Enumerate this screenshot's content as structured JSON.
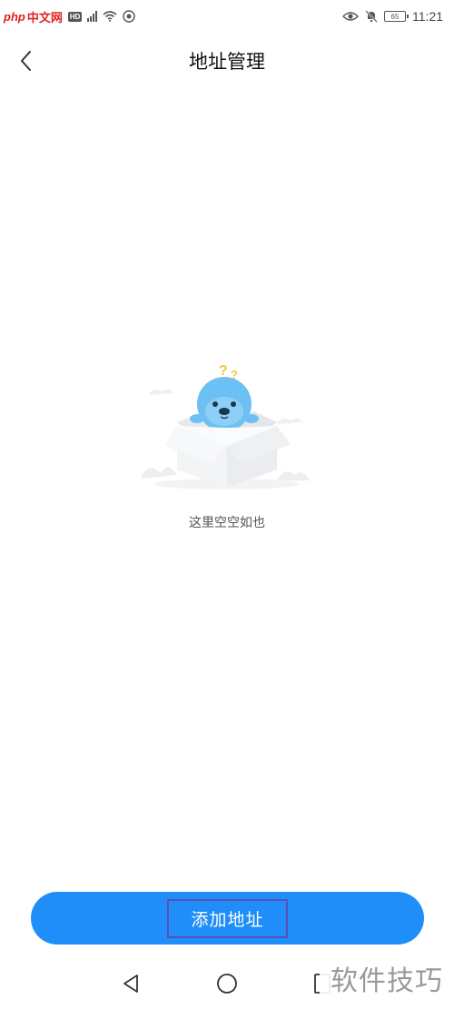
{
  "status_bar": {
    "logo_php": "php",
    "logo_cn": "中文网",
    "hd_label": "HD",
    "battery": "65",
    "time": "11:21"
  },
  "header": {
    "title": "地址管理"
  },
  "empty_state": {
    "message": "这里空空如也"
  },
  "actions": {
    "add_address": "添加地址"
  },
  "watermark": {
    "text": "软件技巧"
  },
  "colors": {
    "primary": "#1f8ef8",
    "mascot": "#6cc0f3"
  }
}
